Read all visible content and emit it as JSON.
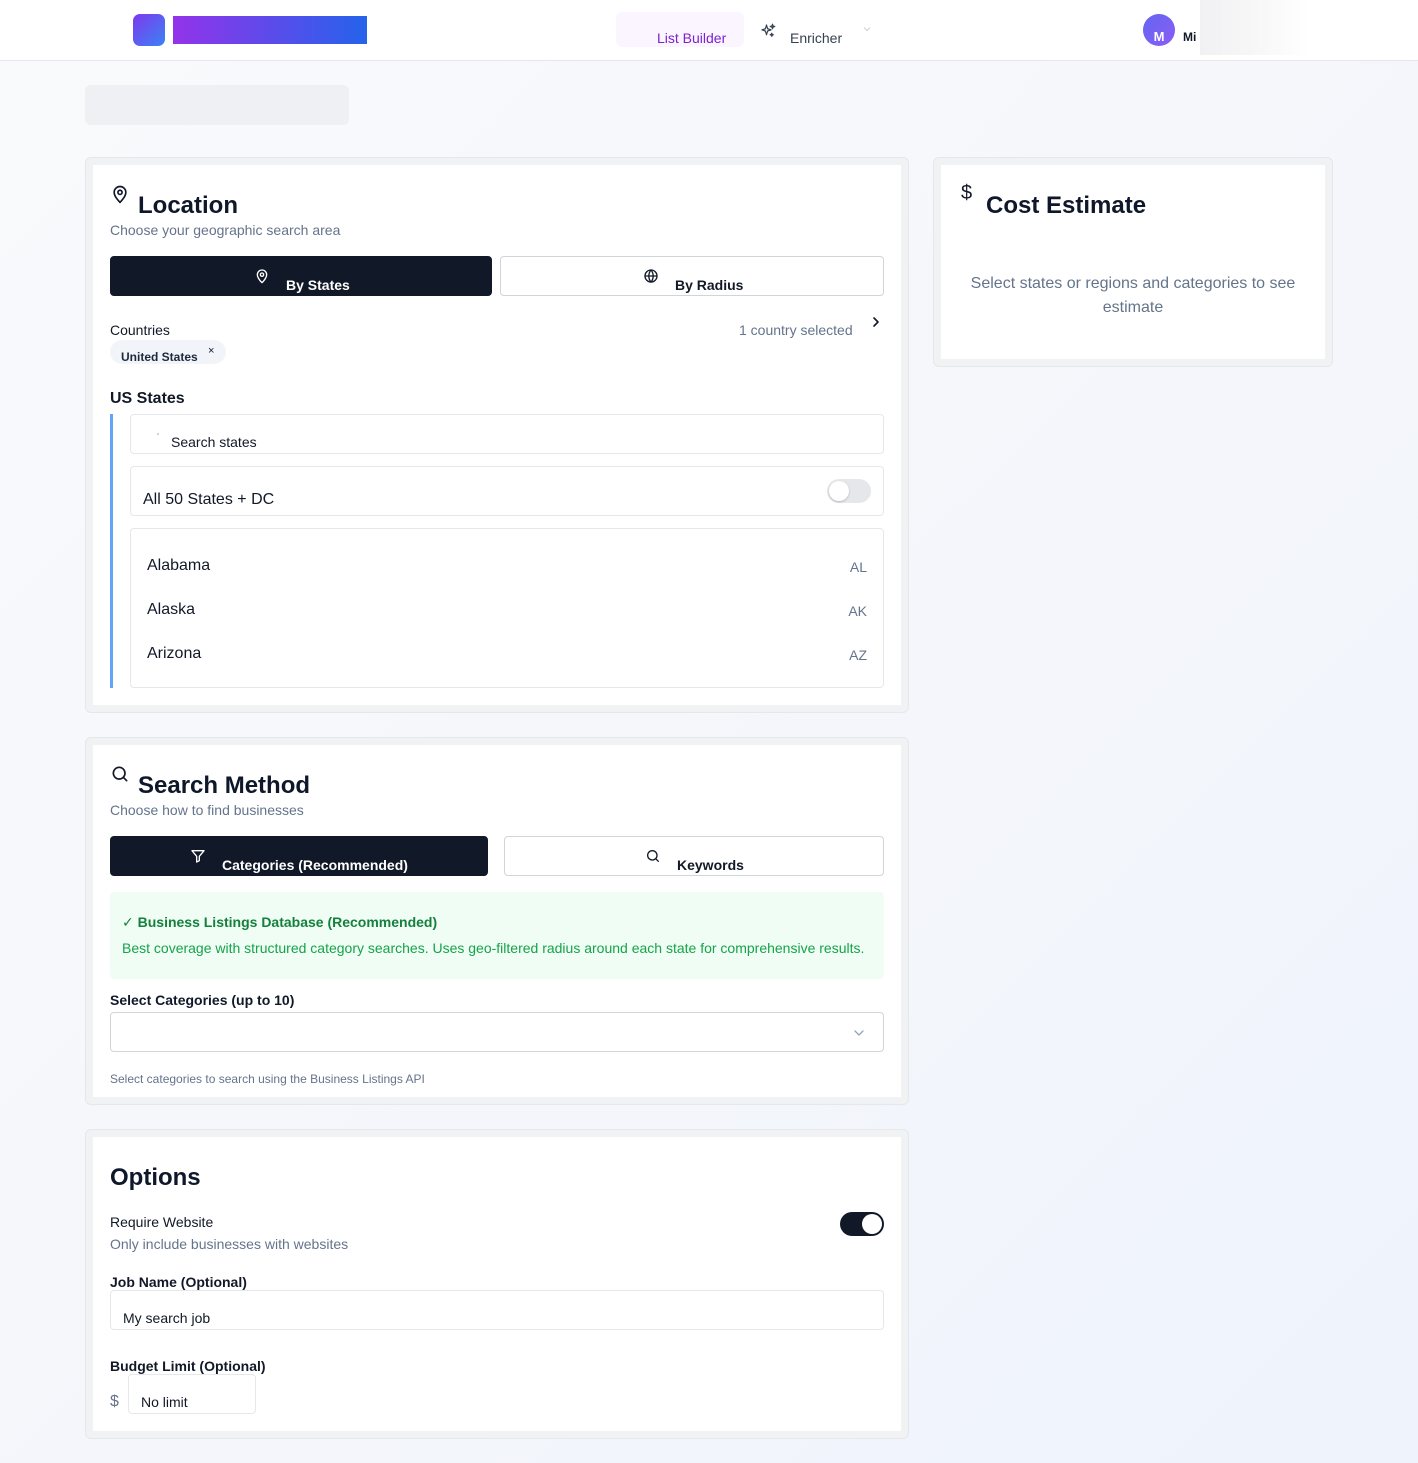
{
  "header": {
    "nav": {
      "list_builder": "List Builder",
      "enricher": "Enricher"
    },
    "user": {
      "avatar_initial": "M",
      "name": "Mi"
    }
  },
  "location": {
    "title": "Location",
    "subtitle": "Choose your geographic search area",
    "mode_by_states": "By States",
    "mode_by_radius": "By Radius",
    "countries_label": "Countries",
    "countries_count": "1 country selected",
    "country_chip": "United States",
    "chip_remove": "×",
    "us_states_label": "US States",
    "search_placeholder": "Search states",
    "all_states_label": "All 50 States + DC",
    "all_states_enabled": false,
    "states": [
      {
        "name": "Alabama",
        "code": "AL"
      },
      {
        "name": "Alaska",
        "code": "AK"
      },
      {
        "name": "Arizona",
        "code": "AZ"
      }
    ]
  },
  "search_method": {
    "title": "Search Method",
    "subtitle": "Choose how to find businesses",
    "mode_categories": "Categories (Recommended)",
    "mode_keywords": "Keywords",
    "info_title": "✓ Business Listings Database (Recommended)",
    "info_text": "Best coverage with structured category searches. Uses geo-filtered radius around each state for comprehensive results.",
    "categories_label": "Select Categories (up to 10)",
    "categories_hint": "Select categories to search using the Business Listings API"
  },
  "options": {
    "title": "Options",
    "require_website_label": "Require Website",
    "require_website_desc": "Only include businesses with websites",
    "require_website_enabled": true,
    "job_name_label": "Job Name (Optional)",
    "job_name_placeholder": "My search job",
    "budget_label": "Budget Limit (Optional)",
    "budget_currency": "$",
    "budget_placeholder": "No limit"
  },
  "cost_estimate": {
    "icon_symbol": "$",
    "title": "Cost Estimate",
    "message": "Select states or regions and categories to see estimate"
  },
  "colors": {
    "primary_dark": "#111827",
    "accent_purple": "#7e22ce",
    "success_green": "#16a34a",
    "states_accent": "#60a5fa"
  }
}
